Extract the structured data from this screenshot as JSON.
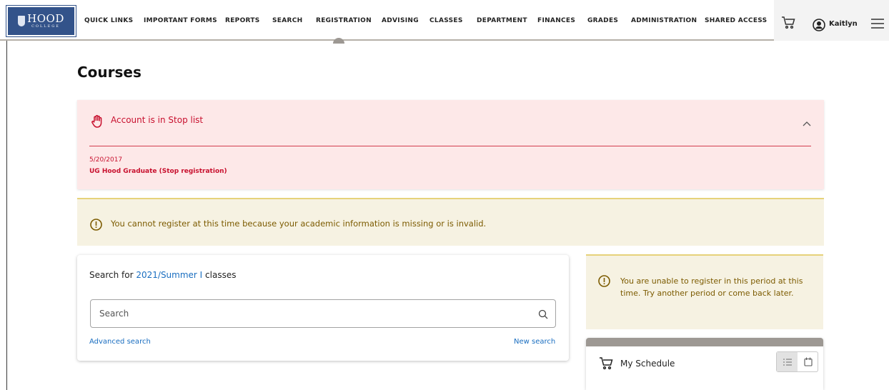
{
  "nav": {
    "items": [
      {
        "label": "QUICK LINKS"
      },
      {
        "label": "IMPORTANT FORMS"
      },
      {
        "label": "REPORTS"
      },
      {
        "label": "SEARCH"
      },
      {
        "label": "REGISTRATION"
      },
      {
        "label": "ADVISING"
      },
      {
        "label": "CLASSES"
      },
      {
        "label": "DEPARTMENT"
      },
      {
        "label": "FINANCES"
      },
      {
        "label": "GRADES"
      },
      {
        "label": "ADMINISTRATION"
      },
      {
        "label": "SHARED ACCESS"
      }
    ],
    "active": "REGISTRATION",
    "user_name": "Kaitlyn",
    "logo_text": "HOOD",
    "logo_subtext": "COLLEGE"
  },
  "page": {
    "title": "Courses"
  },
  "stop_alert": {
    "title": "Account is in Stop list",
    "date": "5/20/2017",
    "reason": "UG Hood Graduate (Stop registration)"
  },
  "warning": {
    "text": "You cannot register at this time because your academic information is missing or is invalid."
  },
  "search": {
    "prefix": "Search for ",
    "term": "2021/Summer I",
    "suffix": " classes",
    "placeholder": "Search",
    "advanced_label": "Advanced search",
    "new_label": "New search"
  },
  "period_notice": {
    "text": "You are unable to register in this period at this time. Try another period or come back later."
  },
  "schedule": {
    "title": "My Schedule"
  },
  "colors": {
    "stop_red": "#c8102e",
    "warning_text": "#7c5b00",
    "link_blue": "#1a6ec0",
    "logo_blue": "#33538a"
  }
}
